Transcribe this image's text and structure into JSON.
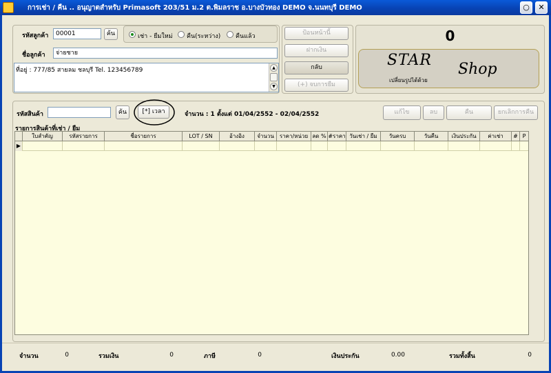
{
  "window": {
    "title": "การเช่า / คืน .. อนุญาตสำหรับ Primasoft 203/51 ม.2 ต.พิมลราช อ.บางบัวทอง DEMO จ.นนทบุรี DEMO",
    "minimize": "○",
    "close": "✕"
  },
  "customer": {
    "code_label": "รหัสลูกค้า",
    "code_value": "00001",
    "search_btn": "ค้น",
    "name_label": "ชื่อลูกค้า",
    "name_value": "จ่ายชาย",
    "address": "ที่อยู่ : 777/85 สายลม ชลบุรี  Tel. 123456789"
  },
  "mode_radios": [
    {
      "label": "เช่า - ยืมใหม่",
      "selected": true
    },
    {
      "label": "คืน(ระหว่าง)",
      "selected": false
    },
    {
      "label": "คืนแล้ว",
      "selected": false
    }
  ],
  "actions": {
    "prev": "ป้อนหน้านี้",
    "deposit": "ฝากเงิน",
    "back": "กลับ",
    "borrow_list": "(+) จบการยืม"
  },
  "display": {
    "counter": "0",
    "brand_line1": "STAR",
    "brand_line2": "Shop",
    "brand_caption": "เปลี่ยนรูปได้ด้วย"
  },
  "product": {
    "code_label": "รหัสสินค้า",
    "code_value": "",
    "search_btn": "ค้น",
    "reset_btn": "[*] เวลา",
    "summary": "จำนวน : 1  ตั้งแต่ 01/04/2552 - 02/04/2552",
    "list_title": "รายการสินค้าที่เช่า / ยืม"
  },
  "row_actions": {
    "edit": "แก้ไข",
    "delete": "ลบ",
    "return": "คืน",
    "cancel_return": "ยกเลิกการคืน"
  },
  "grid": {
    "columns": [
      "ใบสำคัญ",
      "รหัสรายการ",
      "ชื่อรายการ",
      "LOT / SN",
      "อ้างอิง",
      "จำนวน",
      "ราคา/หน่วย",
      "ลด %",
      "#ราคา",
      "วันเช่า / ยืม",
      "วันครบ",
      "วันคืน",
      "เงินประกัน",
      "ค่าเช่า",
      "#",
      "P"
    ],
    "row_indicator": "▶"
  },
  "footer": {
    "qty_label": "จำนวน",
    "qty_value": "0",
    "sum_label": "รวมเงิน",
    "sum_value": "0",
    "tax_label": "ภาษี",
    "tax_value": "0",
    "deposit_label": "เงินประกัน",
    "deposit_value": "0.00",
    "total_label": "รวมทั้งสิ้น",
    "total_value": "0"
  }
}
